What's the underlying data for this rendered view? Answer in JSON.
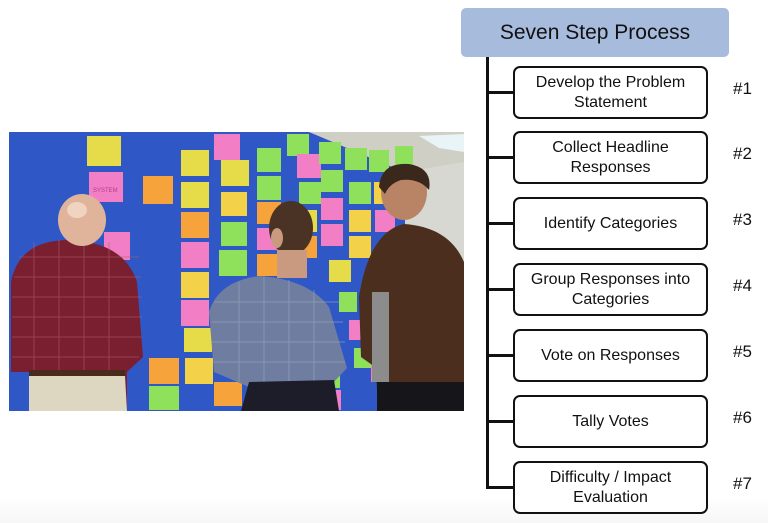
{
  "diagram": {
    "title": "Seven Step Process",
    "title_color": "#a7bbdc",
    "steps": [
      {
        "label": "Develop the Problem Statement",
        "number": "#1"
      },
      {
        "label": "Collect Headline Responses",
        "number": "#2"
      },
      {
        "label": "Identify Categories",
        "number": "#3"
      },
      {
        "label": "Group Responses into Categories",
        "number": "#4"
      },
      {
        "label": "Vote on Responses",
        "number": "#5"
      },
      {
        "label": "Tally Votes",
        "number": "#6"
      },
      {
        "label": "Difficulty / Impact Evaluation",
        "number": "#7"
      }
    ]
  },
  "photo": {
    "description": "Three men reviewing colored sticky notes on a blue wall",
    "wall_color": "#2f58c6",
    "note_colors": [
      "#e6dc4a",
      "#f27fc5",
      "#f5a33a",
      "#8fe05a",
      "#f3d24a"
    ],
    "legible_notes": [
      "SYSTEM"
    ]
  }
}
